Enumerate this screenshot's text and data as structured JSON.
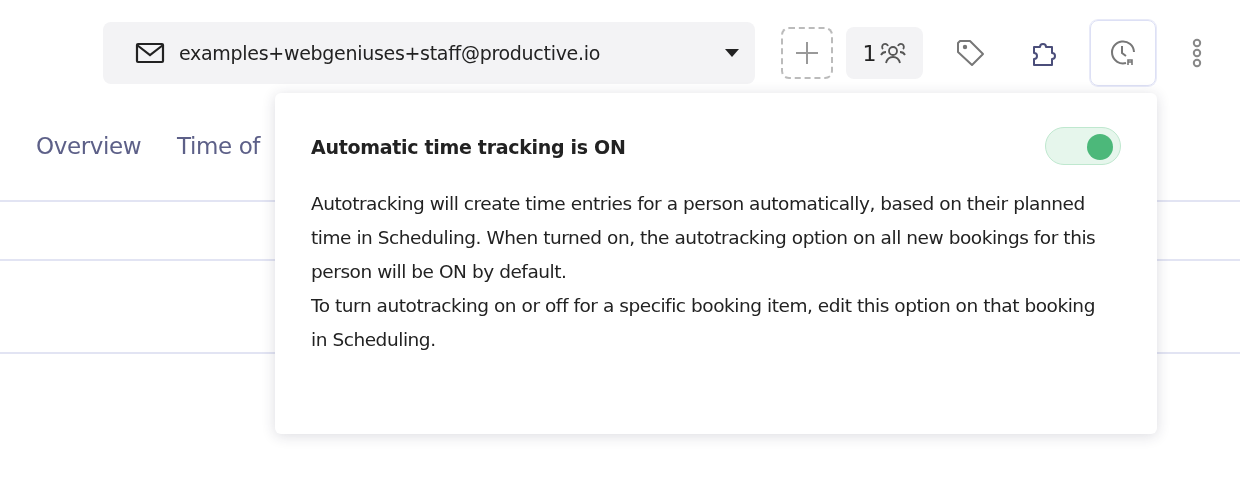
{
  "account_menu": {
    "label": "examples+webgeniuses+staff@productive.io"
  },
  "toolbar": [
    {
      "kind": "add",
      "active": false
    },
    {
      "kind": "people",
      "count": "1",
      "active": false
    },
    {
      "kind": "tag",
      "active": false
    },
    {
      "kind": "puzzle",
      "active": false
    },
    {
      "kind": "clock",
      "active": true
    },
    {
      "kind": "more",
      "active": false
    }
  ],
  "tabs": [
    {
      "label": "Overview",
      "selected": false
    },
    {
      "label": "Time of",
      "selected": false
    }
  ],
  "popover": {
    "title": "Automatic time tracking is ON",
    "on": true,
    "paragraphs": [
      "Autotracking will create time entries for a person automatically, based on their planned time in Scheduling. When turned on, the autotracking option on all new bookings for this person will be ON by default.",
      "To turn autotracking on or off for a specific booking item, edit this option on that booking in Scheduling."
    ]
  }
}
